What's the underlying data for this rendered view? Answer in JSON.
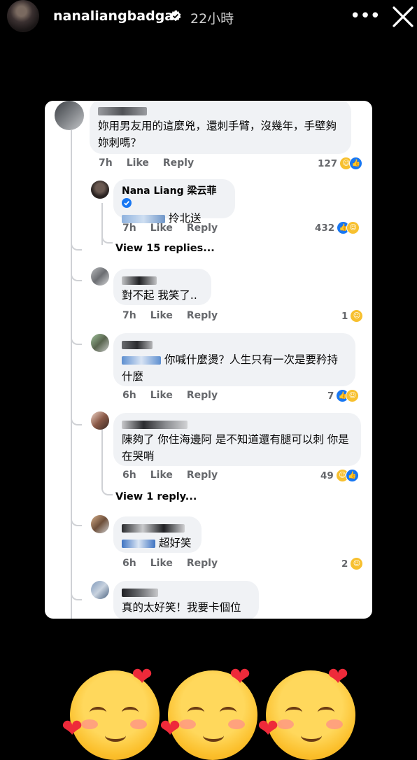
{
  "story": {
    "username": "nanaliangbadgal",
    "time": "22小時",
    "more_icon": "more-dots-icon",
    "close_icon": "close-icon"
  },
  "comments": [
    {
      "text": "妳用男友用的這麼兇，還刺手臂，沒幾年，手壁夠妳刺嗎？",
      "time": "7h",
      "like": "Like",
      "reply": "Reply",
      "count": "127",
      "reactions": [
        "haha",
        "like"
      ]
    },
    {
      "name": "Nana Liang 梁云菲",
      "verified": true,
      "text": "拎北送",
      "time": "7h",
      "like": "Like",
      "reply": "Reply",
      "count": "432",
      "reactions": [
        "like",
        "haha"
      ]
    },
    {
      "text": "對不起 我笑了..",
      "time": "7h",
      "like": "Like",
      "reply": "Reply",
      "count": "1",
      "reactions": [
        "haha"
      ]
    },
    {
      "text": "你喊什麼燙？人生只有一次是要矜持什麼",
      "time": "6h",
      "like": "Like",
      "reply": "Reply",
      "count": "7",
      "reactions": [
        "like",
        "haha"
      ]
    },
    {
      "text": "陳夠了 你住海邊阿 是不知道還有腿可以刺 你是在哭哨",
      "time": "6h",
      "like": "Like",
      "reply": "Reply",
      "count": "49",
      "reactions": [
        "haha",
        "like"
      ]
    },
    {
      "text": "超好笑",
      "time": "6h",
      "like": "Like",
      "reply": "Reply",
      "count": "2",
      "reactions": [
        "haha"
      ]
    },
    {
      "text": "真的太好笑！我要卡個位"
    }
  ],
  "view_replies_1": "View 15 replies...",
  "view_replies_2": "View 1 reply...",
  "colors": {
    "background": "#000000",
    "card": "#ffffff",
    "bubble": "#f0f2f5",
    "meta": "#65676b",
    "like_blue": "#1877f2",
    "haha_yellow": "#f7c02f"
  },
  "bottom_emojis": [
    "smiling-face-with-hearts",
    "smiling-face-with-hearts",
    "smiling-face-with-hearts"
  ]
}
